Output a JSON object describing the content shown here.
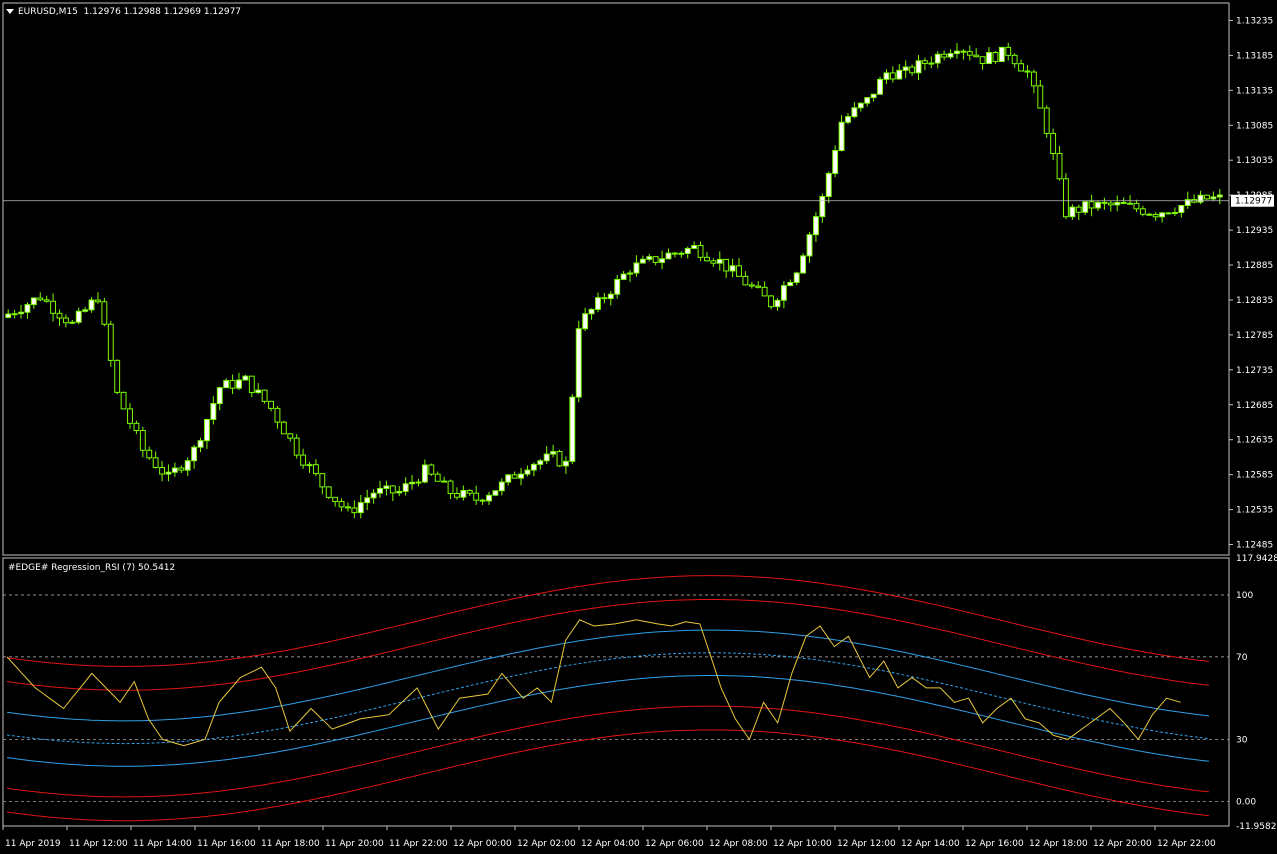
{
  "main_header": {
    "symbol": "EURUSD,M15",
    "ohlc": "1.12976 1.12988 1.12969 1.12977"
  },
  "sub_header": {
    "indicator": "#EDGE# Regression_RSI (7) 50.5412"
  },
  "colors": {
    "bull": "#ffffff",
    "bear": "#000000",
    "wick": "#7cfc00",
    "price_line": "#c0c0c0",
    "rsi": "#e8c83c",
    "regression_blue": "#2f9fe8",
    "regression_red": "#e01414",
    "level_line": "#c0c0c0"
  },
  "chart_data": [
    {
      "type": "candlestick",
      "title": "EURUSD,M15",
      "y_axis_ticks": [
        "1.13235",
        "1.13185",
        "1.13135",
        "1.13085",
        "1.13035",
        "1.12985",
        "1.12935",
        "1.12885",
        "1.12835",
        "1.12785",
        "1.12735",
        "1.12685",
        "1.12635",
        "1.12585",
        "1.12535",
        "1.12485"
      ],
      "ylim": [
        1.1247,
        1.1326
      ],
      "current_price": "1.12977",
      "x_axis_ticks": [
        "11 Apr 2019",
        "11 Apr 12:00",
        "11 Apr 14:00",
        "11 Apr 16:00",
        "11 Apr 18:00",
        "11 Apr 20:00",
        "11 Apr 22:00",
        "12 Apr 00:00",
        "12 Apr 02:00",
        "12 Apr 04:00",
        "12 Apr 06:00",
        "12 Apr 08:00",
        "12 Apr 10:00",
        "12 Apr 12:00",
        "12 Apr 14:00",
        "12 Apr 16:00",
        "12 Apr 18:00",
        "12 Apr 20:00",
        "12 Apr 22:00"
      ],
      "anchors": [
        [
          0,
          1.1281
        ],
        [
          6,
          1.1284
        ],
        [
          11,
          1.128
        ],
        [
          15,
          1.1284
        ],
        [
          18,
          1.127
        ],
        [
          22,
          1.1262
        ],
        [
          26,
          1.1258
        ],
        [
          30,
          1.1262
        ],
        [
          34,
          1.1271
        ],
        [
          38,
          1.1272
        ],
        [
          42,
          1.1268
        ],
        [
          46,
          1.1262
        ],
        [
          50,
          1.1257
        ],
        [
          54,
          1.1253
        ],
        [
          58,
          1.1256
        ],
        [
          62,
          1.1256
        ],
        [
          66,
          1.1259
        ],
        [
          70,
          1.1256
        ],
        [
          74,
          1.1255
        ],
        [
          78,
          1.1257
        ],
        [
          82,
          1.126
        ],
        [
          86,
          1.1261
        ],
        [
          88,
          1.126
        ],
        [
          90,
          1.128
        ],
        [
          94,
          1.1284
        ],
        [
          98,
          1.1288
        ],
        [
          104,
          1.129
        ],
        [
          108,
          1.1291
        ],
        [
          112,
          1.1289
        ],
        [
          116,
          1.1286
        ],
        [
          120,
          1.1283
        ],
        [
          124,
          1.1288
        ],
        [
          128,
          1.1298
        ],
        [
          131,
          1.1309
        ],
        [
          135,
          1.1312
        ],
        [
          138,
          1.1316
        ],
        [
          141,
          1.1316
        ],
        [
          145,
          1.1318
        ],
        [
          149,
          1.132
        ],
        [
          153,
          1.1318
        ],
        [
          157,
          1.1319
        ],
        [
          160,
          1.1316
        ],
        [
          163,
          1.1308
        ],
        [
          166,
          1.1296
        ],
        [
          170,
          1.1297
        ],
        [
          175,
          1.1297
        ],
        [
          180,
          1.1296
        ],
        [
          188,
          1.1298
        ]
      ]
    },
    {
      "type": "line",
      "title": "#EDGE# Regression_RSI (7) 50.5412",
      "y_axis_ticks": [
        "117.9428",
        "100",
        "70",
        "30",
        "0.00",
        "-11.9582"
      ],
      "levels": [
        100,
        70,
        30,
        0
      ],
      "ylim": [
        -11.9582,
        117.9428
      ],
      "rsi_anchors": [
        [
          0,
          70
        ],
        [
          4,
          55
        ],
        [
          8,
          45
        ],
        [
          12,
          62
        ],
        [
          16,
          48
        ],
        [
          18,
          58
        ],
        [
          20,
          40
        ],
        [
          22,
          30
        ],
        [
          25,
          27
        ],
        [
          28,
          30
        ],
        [
          30,
          48
        ],
        [
          33,
          60
        ],
        [
          36,
          65
        ],
        [
          38,
          55
        ],
        [
          40,
          34
        ],
        [
          43,
          45
        ],
        [
          46,
          35
        ],
        [
          50,
          40
        ],
        [
          54,
          42
        ],
        [
          58,
          55
        ],
        [
          61,
          35
        ],
        [
          64,
          50
        ],
        [
          68,
          52
        ],
        [
          70,
          62
        ],
        [
          73,
          50
        ],
        [
          75,
          55
        ],
        [
          77,
          48
        ],
        [
          79,
          78
        ],
        [
          81,
          88
        ],
        [
          83,
          85
        ],
        [
          86,
          86
        ],
        [
          89,
          88
        ],
        [
          92,
          86
        ],
        [
          94,
          85
        ],
        [
          96,
          87
        ],
        [
          98,
          86
        ],
        [
          101,
          55
        ],
        [
          103,
          40
        ],
        [
          105,
          30
        ],
        [
          107,
          48
        ],
        [
          109,
          38
        ],
        [
          111,
          62
        ],
        [
          113,
          80
        ],
        [
          115,
          85
        ],
        [
          117,
          75
        ],
        [
          119,
          80
        ],
        [
          122,
          60
        ],
        [
          124,
          68
        ],
        [
          126,
          55
        ],
        [
          128,
          60
        ],
        [
          130,
          55
        ],
        [
          132,
          55
        ],
        [
          134,
          48
        ],
        [
          136,
          50
        ],
        [
          138,
          38
        ],
        [
          140,
          45
        ],
        [
          142,
          50
        ],
        [
          144,
          40
        ],
        [
          146,
          38
        ],
        [
          148,
          32
        ],
        [
          150,
          30
        ],
        [
          152,
          35
        ],
        [
          154,
          40
        ],
        [
          156,
          45
        ],
        [
          158,
          38
        ],
        [
          160,
          30
        ],
        [
          162,
          42
        ],
        [
          164,
          50
        ],
        [
          166,
          48
        ]
      ],
      "regression_bands": [
        {
          "name": "outer_upper",
          "color": "red"
        },
        {
          "name": "inner_upper",
          "color": "red"
        },
        {
          "name": "mid_upper",
          "color": "blue"
        },
        {
          "name": "center",
          "color": "blue"
        },
        {
          "name": "mid_lower",
          "color": "blue"
        },
        {
          "name": "inner_lower",
          "color": "red"
        },
        {
          "name": "outer_lower",
          "color": "red"
        }
      ]
    }
  ]
}
